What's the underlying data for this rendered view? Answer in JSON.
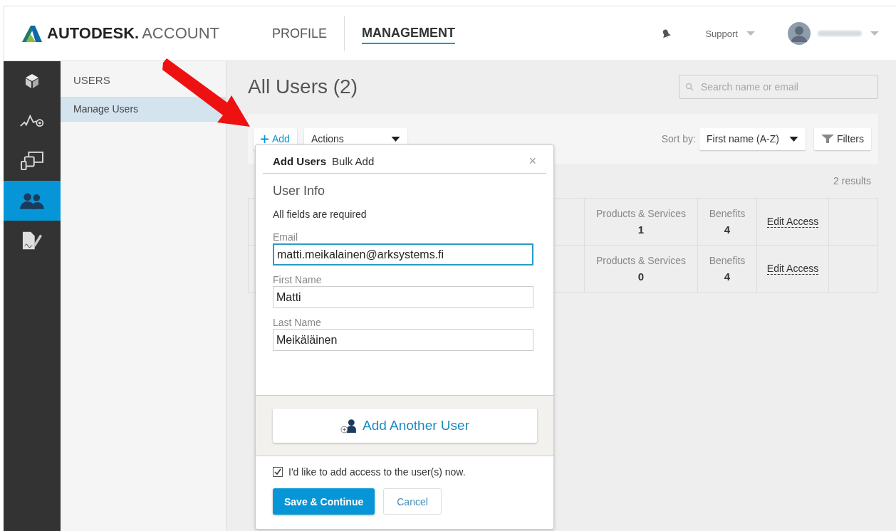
{
  "header": {
    "brand": "AUTODESK",
    "brand_suffix": ".",
    "product": "ACCOUNT",
    "nav": [
      {
        "label": "PROFILE",
        "selected": false
      },
      {
        "label": "MANAGEMENT",
        "selected": true
      }
    ],
    "support": "Support"
  },
  "rail": [
    {
      "kind": "cube",
      "selected": false
    },
    {
      "kind": "activity",
      "selected": false
    },
    {
      "kind": "devices",
      "selected": false
    },
    {
      "kind": "users",
      "selected": true
    },
    {
      "kind": "signature",
      "selected": false
    }
  ],
  "sidebar": {
    "heading": "USERS",
    "items": [
      {
        "label": "Manage Users",
        "selected": true
      }
    ]
  },
  "main": {
    "title": "All Users (2)",
    "search": {
      "placeholder": "Search name or email"
    },
    "add": "Add",
    "actions": "Actions",
    "sort_label": "Sort by:",
    "sort_value": "First name (A-Z)",
    "filters": "Filters",
    "results": "2 results",
    "rows": [
      {
        "products_label": "Products & Services",
        "products_count": "1",
        "benefits_label": "Benefits",
        "benefits_count": "4",
        "link": "Edit Access"
      },
      {
        "products_label": "Products & Services",
        "products_count": "0",
        "benefits_label": "Benefits",
        "benefits_count": "4",
        "link": "Edit Access"
      }
    ]
  },
  "dialog": {
    "tabs": [
      {
        "label": "Add Users",
        "selected": true
      },
      {
        "label": "Bulk Add",
        "selected": false
      }
    ],
    "close": "×",
    "section": "User Info",
    "note": "All fields are required",
    "fields": [
      {
        "label": "Email",
        "value": "matti.meikalainen@arksystems.fi",
        "focused": true
      },
      {
        "label": "First Name",
        "value": "Matti",
        "focused": false
      },
      {
        "label": "Last Name",
        "value": "Meikäläinen",
        "focused": false
      }
    ],
    "add_another": "Add Another User",
    "consent": {
      "label": "I'd like to add access to the user(s) now.",
      "checked": true
    },
    "primary": "Save & Continue",
    "cancel": "Cancel"
  }
}
